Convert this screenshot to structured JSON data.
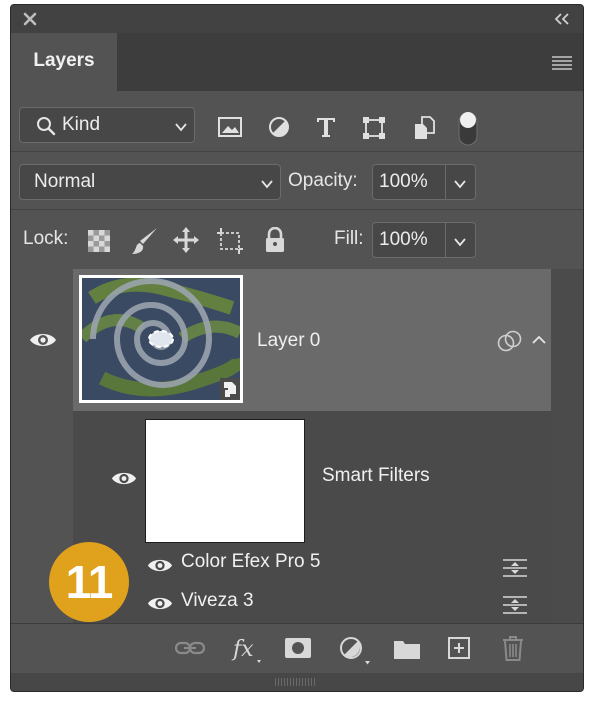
{
  "panel": {
    "tab_label": "Layers"
  },
  "filter_bar": {
    "kind_label": "Kind"
  },
  "blend": {
    "mode_value": "Normal",
    "opacity_label": "Opacity:",
    "opacity_value": "100%"
  },
  "lock_row": {
    "lock_label": "Lock:",
    "fill_label": "Fill:",
    "fill_value": "100%"
  },
  "layers": [
    {
      "name": "Layer 0",
      "selected": true,
      "visible": true,
      "type": "smart-object"
    }
  ],
  "smart_filters": {
    "label": "Smart Filters",
    "items": [
      {
        "name": "Color Efex Pro 5"
      },
      {
        "name": "Viveza 3"
      }
    ]
  },
  "step_badge": "11",
  "colors": {
    "panel_bg": "#535353",
    "selected_row": "#6a6a6a",
    "badge": "#e0a21c"
  },
  "icons": {
    "filter_types": [
      "image-filter-icon",
      "adjustment-filter-icon",
      "type-filter-icon",
      "shape-filter-icon",
      "smart-object-filter-icon",
      "filter-toggle-icon"
    ],
    "locks": [
      "lock-transparent-pixels-icon",
      "lock-image-pixels-icon",
      "lock-position-icon",
      "lock-artboard-icon",
      "lock-all-icon"
    ],
    "bottom": [
      "link-layers-icon",
      "fx-icon",
      "add-mask-icon",
      "new-adjustment-icon",
      "new-group-icon",
      "new-layer-icon",
      "delete-layer-icon"
    ]
  }
}
